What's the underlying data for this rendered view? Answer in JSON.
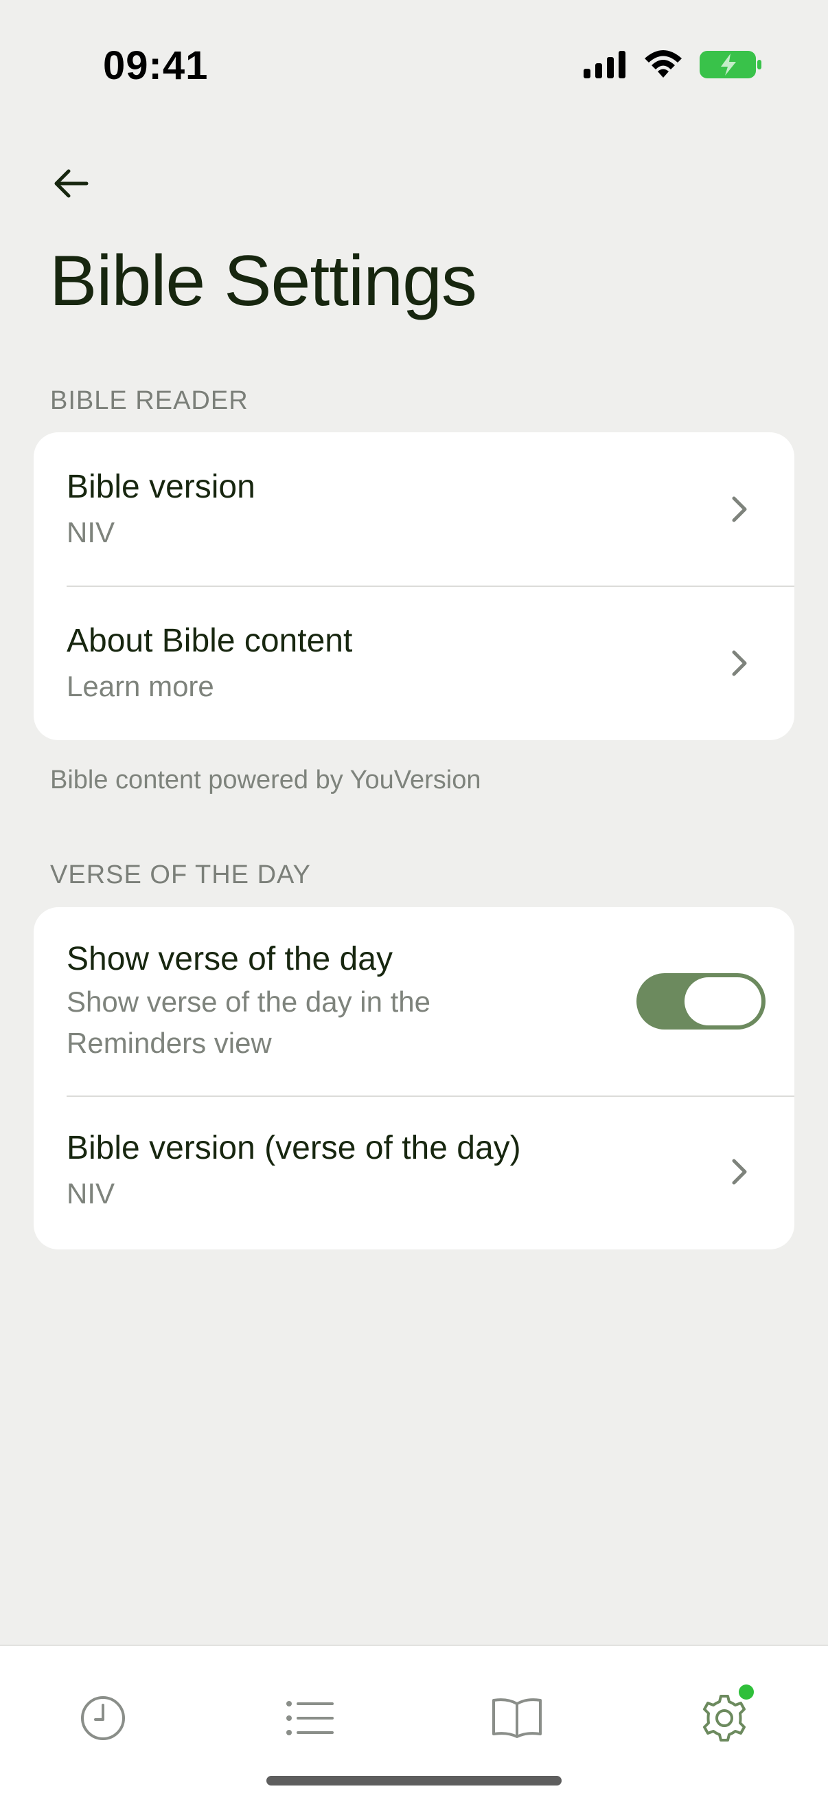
{
  "status_bar": {
    "time": "09:41"
  },
  "page": {
    "title": "Bible Settings"
  },
  "sections": {
    "bible_reader": {
      "header": "BIBLE READER",
      "items": [
        {
          "title": "Bible version",
          "subtitle": "NIV"
        },
        {
          "title": "About Bible content",
          "subtitle": "Learn more"
        }
      ],
      "footnote": "Bible content powered by YouVersion"
    },
    "verse_of_the_day": {
      "header": "VERSE OF THE DAY",
      "toggle_item": {
        "title": "Show verse of the day",
        "subtitle_line1": "Show verse of the day in the",
        "subtitle_line2": "Reminders view",
        "enabled": true
      },
      "items": [
        {
          "title": "Bible version (verse of the day)",
          "subtitle": "NIV"
        }
      ]
    }
  },
  "tab_bar": {
    "tabs": [
      {
        "icon": "clock-icon",
        "active": false
      },
      {
        "icon": "list-icon",
        "active": false
      },
      {
        "icon": "book-icon",
        "active": false
      },
      {
        "icon": "gear-icon",
        "active": true,
        "badge": true
      }
    ]
  },
  "colors": {
    "accent": "#6c8a5e",
    "text_primary": "#17260f",
    "text_secondary": "#7e837c",
    "background": "#efefed",
    "badge": "#2fbf3a"
  }
}
